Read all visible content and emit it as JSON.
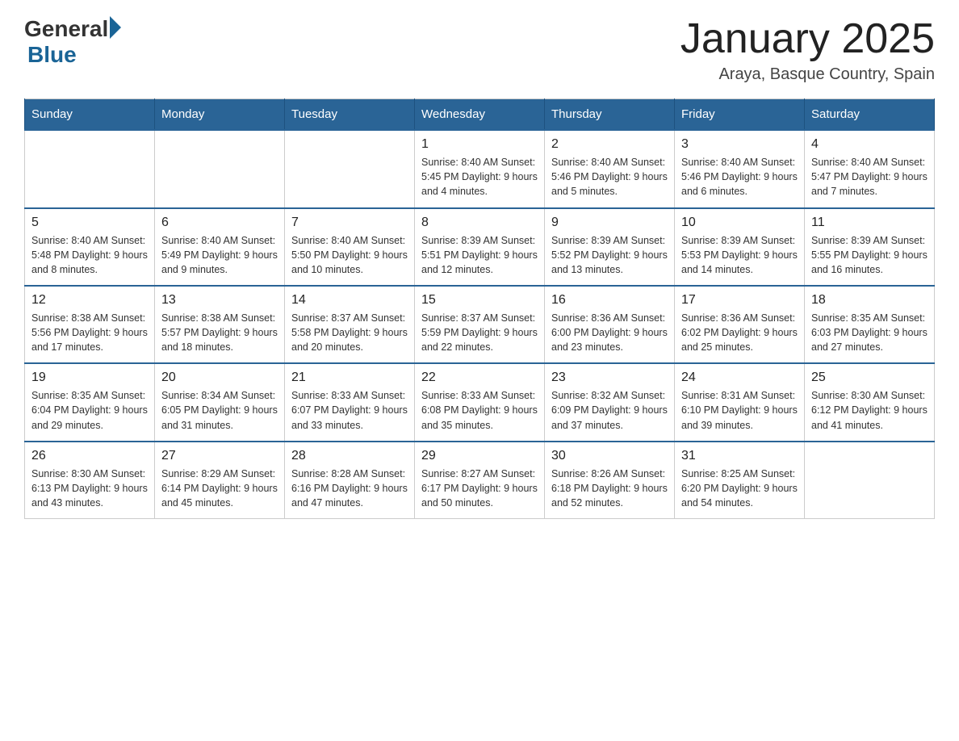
{
  "header": {
    "logo_general": "General",
    "logo_blue": "Blue",
    "title": "January 2025",
    "location": "Araya, Basque Country, Spain"
  },
  "days_of_week": [
    "Sunday",
    "Monday",
    "Tuesday",
    "Wednesday",
    "Thursday",
    "Friday",
    "Saturday"
  ],
  "weeks": [
    [
      {
        "day": "",
        "info": ""
      },
      {
        "day": "",
        "info": ""
      },
      {
        "day": "",
        "info": ""
      },
      {
        "day": "1",
        "info": "Sunrise: 8:40 AM\nSunset: 5:45 PM\nDaylight: 9 hours\nand 4 minutes."
      },
      {
        "day": "2",
        "info": "Sunrise: 8:40 AM\nSunset: 5:46 PM\nDaylight: 9 hours\nand 5 minutes."
      },
      {
        "day": "3",
        "info": "Sunrise: 8:40 AM\nSunset: 5:46 PM\nDaylight: 9 hours\nand 6 minutes."
      },
      {
        "day": "4",
        "info": "Sunrise: 8:40 AM\nSunset: 5:47 PM\nDaylight: 9 hours\nand 7 minutes."
      }
    ],
    [
      {
        "day": "5",
        "info": "Sunrise: 8:40 AM\nSunset: 5:48 PM\nDaylight: 9 hours\nand 8 minutes."
      },
      {
        "day": "6",
        "info": "Sunrise: 8:40 AM\nSunset: 5:49 PM\nDaylight: 9 hours\nand 9 minutes."
      },
      {
        "day": "7",
        "info": "Sunrise: 8:40 AM\nSunset: 5:50 PM\nDaylight: 9 hours\nand 10 minutes."
      },
      {
        "day": "8",
        "info": "Sunrise: 8:39 AM\nSunset: 5:51 PM\nDaylight: 9 hours\nand 12 minutes."
      },
      {
        "day": "9",
        "info": "Sunrise: 8:39 AM\nSunset: 5:52 PM\nDaylight: 9 hours\nand 13 minutes."
      },
      {
        "day": "10",
        "info": "Sunrise: 8:39 AM\nSunset: 5:53 PM\nDaylight: 9 hours\nand 14 minutes."
      },
      {
        "day": "11",
        "info": "Sunrise: 8:39 AM\nSunset: 5:55 PM\nDaylight: 9 hours\nand 16 minutes."
      }
    ],
    [
      {
        "day": "12",
        "info": "Sunrise: 8:38 AM\nSunset: 5:56 PM\nDaylight: 9 hours\nand 17 minutes."
      },
      {
        "day": "13",
        "info": "Sunrise: 8:38 AM\nSunset: 5:57 PM\nDaylight: 9 hours\nand 18 minutes."
      },
      {
        "day": "14",
        "info": "Sunrise: 8:37 AM\nSunset: 5:58 PM\nDaylight: 9 hours\nand 20 minutes."
      },
      {
        "day": "15",
        "info": "Sunrise: 8:37 AM\nSunset: 5:59 PM\nDaylight: 9 hours\nand 22 minutes."
      },
      {
        "day": "16",
        "info": "Sunrise: 8:36 AM\nSunset: 6:00 PM\nDaylight: 9 hours\nand 23 minutes."
      },
      {
        "day": "17",
        "info": "Sunrise: 8:36 AM\nSunset: 6:02 PM\nDaylight: 9 hours\nand 25 minutes."
      },
      {
        "day": "18",
        "info": "Sunrise: 8:35 AM\nSunset: 6:03 PM\nDaylight: 9 hours\nand 27 minutes."
      }
    ],
    [
      {
        "day": "19",
        "info": "Sunrise: 8:35 AM\nSunset: 6:04 PM\nDaylight: 9 hours\nand 29 minutes."
      },
      {
        "day": "20",
        "info": "Sunrise: 8:34 AM\nSunset: 6:05 PM\nDaylight: 9 hours\nand 31 minutes."
      },
      {
        "day": "21",
        "info": "Sunrise: 8:33 AM\nSunset: 6:07 PM\nDaylight: 9 hours\nand 33 minutes."
      },
      {
        "day": "22",
        "info": "Sunrise: 8:33 AM\nSunset: 6:08 PM\nDaylight: 9 hours\nand 35 minutes."
      },
      {
        "day": "23",
        "info": "Sunrise: 8:32 AM\nSunset: 6:09 PM\nDaylight: 9 hours\nand 37 minutes."
      },
      {
        "day": "24",
        "info": "Sunrise: 8:31 AM\nSunset: 6:10 PM\nDaylight: 9 hours\nand 39 minutes."
      },
      {
        "day": "25",
        "info": "Sunrise: 8:30 AM\nSunset: 6:12 PM\nDaylight: 9 hours\nand 41 minutes."
      }
    ],
    [
      {
        "day": "26",
        "info": "Sunrise: 8:30 AM\nSunset: 6:13 PM\nDaylight: 9 hours\nand 43 minutes."
      },
      {
        "day": "27",
        "info": "Sunrise: 8:29 AM\nSunset: 6:14 PM\nDaylight: 9 hours\nand 45 minutes."
      },
      {
        "day": "28",
        "info": "Sunrise: 8:28 AM\nSunset: 6:16 PM\nDaylight: 9 hours\nand 47 minutes."
      },
      {
        "day": "29",
        "info": "Sunrise: 8:27 AM\nSunset: 6:17 PM\nDaylight: 9 hours\nand 50 minutes."
      },
      {
        "day": "30",
        "info": "Sunrise: 8:26 AM\nSunset: 6:18 PM\nDaylight: 9 hours\nand 52 minutes."
      },
      {
        "day": "31",
        "info": "Sunrise: 8:25 AM\nSunset: 6:20 PM\nDaylight: 9 hours\nand 54 minutes."
      },
      {
        "day": "",
        "info": ""
      }
    ]
  ]
}
